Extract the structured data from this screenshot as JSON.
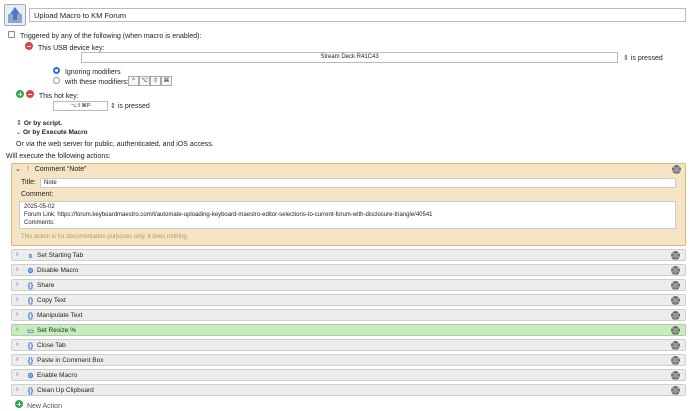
{
  "macro": {
    "name": "Upload Macro to KM Forum"
  },
  "trigger": {
    "checkbox_label": "Triggered by any of the following (when macro is enabled):",
    "usb_label": "This USB device key:",
    "usb_device": "Stream Deck R41C43",
    "usb_condition": "is pressed",
    "ignoring_label": "Ignoring modifiers",
    "with_label": "with these modifiers:",
    "modifiers": [
      "^",
      "⌥",
      "⇧",
      "⌘"
    ],
    "hotkey_label": "This hot key:",
    "hotkey_value": "⌥⇧⌘P",
    "hotkey_condition": "is pressed",
    "or_script": "Or by script.",
    "or_execute": "Or by Execute Macro",
    "web_text": "Or via the web server for public, authenticated, and iOS access."
  },
  "actions_header": "Will execute the following actions:",
  "comment": {
    "header": "Comment “Note”",
    "title_label": "Title:",
    "title_value": "Note",
    "comment_label": "Comment:",
    "line1": "2025-05-02",
    "line2": "Forum Link: https://forum.keyboardmaestro.com/t/automate-uploading-keyboard-maestro-editor-selections-to-current-forum-with-disclosure-triangle/40541",
    "line3": "Comments:",
    "doc_note": "This action is for documentation purposes only, it does nothing."
  },
  "actions": [
    {
      "label": "Set Starting Tab",
      "icon": "variable-icon",
      "glyph": "x"
    },
    {
      "label": "Disable Macro",
      "icon": "macro-icon",
      "glyph": "⚙"
    },
    {
      "label": "Share",
      "icon": "braces-icon",
      "glyph": "{}"
    },
    {
      "label": "Copy Text",
      "icon": "braces-icon",
      "glyph": "{}"
    },
    {
      "label": "Manipulate Text",
      "icon": "braces-icon",
      "glyph": "{}"
    },
    {
      "label": "Set Resize %",
      "icon": "window-icon",
      "glyph": "▭"
    },
    {
      "label": "Close Tab",
      "icon": "braces-icon",
      "glyph": "{}"
    },
    {
      "label": "Paste in Comment Box",
      "icon": "braces-icon",
      "glyph": "{}"
    },
    {
      "label": "Enable Macro",
      "icon": "macro-icon",
      "glyph": "⚙"
    },
    {
      "label": "Clean Up Clipboard",
      "icon": "braces-icon",
      "glyph": "{}"
    }
  ],
  "new_action": "New Action",
  "colors": {
    "comment_bg": "#f5e4c3",
    "highlight_row": "#c8ecc0",
    "accent": "#2a6fd8"
  }
}
